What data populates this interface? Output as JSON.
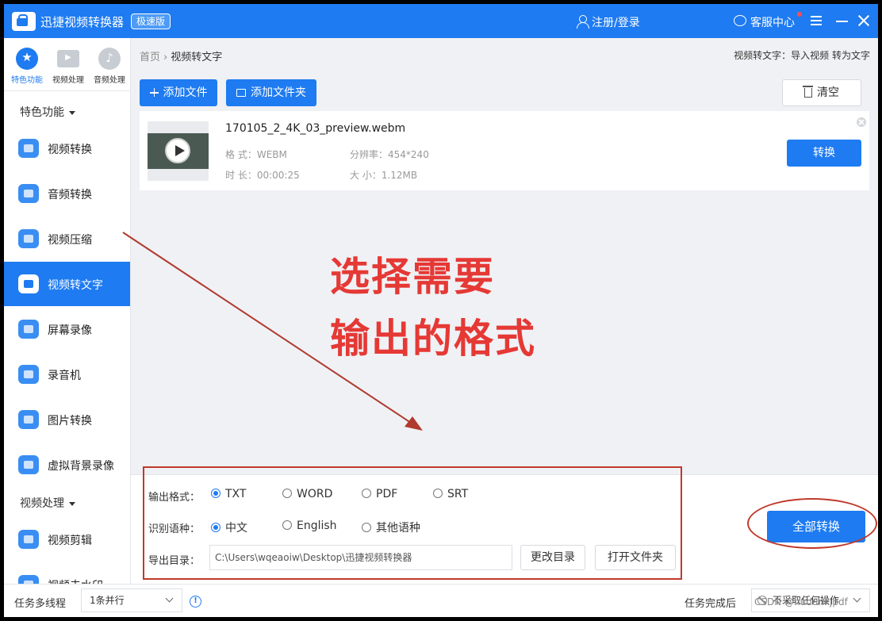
{
  "titlebar": {
    "app_title": "迅捷视频转换器",
    "edition": "极速版",
    "login": "注册/登录",
    "service": "客服中心"
  },
  "sidebar": {
    "top_tabs": [
      {
        "label": "特色功能",
        "icon": "star-icon",
        "active": true
      },
      {
        "label": "视频处理",
        "icon": "film-icon",
        "active": false
      },
      {
        "label": "音频处理",
        "icon": "music-icon",
        "active": false
      }
    ],
    "section1": "特色功能",
    "items": [
      {
        "label": "视频转换",
        "icon": "video-convert-icon"
      },
      {
        "label": "音频转换",
        "icon": "audio-convert-icon"
      },
      {
        "label": "视频压缩",
        "icon": "video-compress-icon"
      },
      {
        "label": "视频转文字",
        "icon": "video-to-text-icon",
        "active": true
      },
      {
        "label": "屏幕录像",
        "icon": "screen-record-icon"
      },
      {
        "label": "录音机",
        "icon": "recorder-icon"
      },
      {
        "label": "图片转换",
        "icon": "image-convert-icon"
      },
      {
        "label": "虚拟背景录像",
        "icon": "virtual-bg-icon"
      }
    ],
    "section2": "视频处理",
    "items2": [
      {
        "label": "视频剪辑",
        "icon": "video-edit-icon"
      },
      {
        "label": "视频去水印",
        "icon": "video-watermark-icon"
      }
    ]
  },
  "breadcrumb": {
    "home": "首页",
    "current": "视频转文字"
  },
  "hint": "视频转文字：导入视频 转为文字",
  "toolbar": {
    "add_file": "添加文件",
    "add_folder": "添加文件夹",
    "clear": "清空"
  },
  "file": {
    "name": "170105_2_4K_03_preview.webm",
    "format_label": "格  式：",
    "format": "WEBM",
    "duration_label": "时  长：",
    "duration": "00:00:25",
    "resolution_label": "分辨率：",
    "resolution": "454*240",
    "size_label": "大  小：",
    "size": "1.12MB",
    "convert": "转换"
  },
  "annotation": {
    "line1": "选择需要",
    "line2": "输出的格式"
  },
  "options": {
    "format_label": "输出格式：",
    "formats": [
      "TXT",
      "WORD",
      "PDF",
      "SRT"
    ],
    "language_label": "识别语种：",
    "languages": [
      "中文",
      "English",
      "其他语种"
    ],
    "dir_label": "导出目录：",
    "dir_value": "C:\\Users\\wqeaoiw\\Desktop\\迅捷视频转换器",
    "change_dir": "更改目录",
    "open_folder": "打开文件夹",
    "convert_all": "全部转换"
  },
  "footer": {
    "multi_label": "任务多线程",
    "multi_value": "1条并行",
    "after_label": "任务完成后",
    "after_value": "不采取任何操作"
  },
  "watermark": "CSDN @hudunkjpdf",
  "colors": {
    "accent": "#1e7bf1",
    "annotation": "#e53935",
    "highlight_border": "#c0392b"
  }
}
